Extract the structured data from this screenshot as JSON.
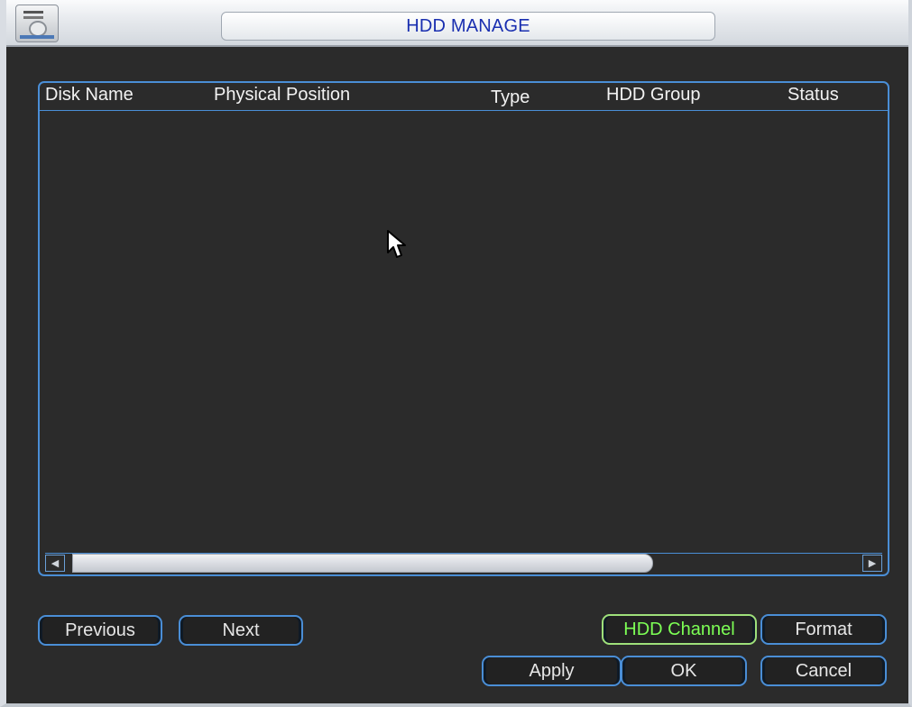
{
  "window": {
    "title": "HDD MANAGE"
  },
  "table": {
    "columns": [
      "Disk Name",
      "Physical Position",
      "Type",
      "HDD Group",
      "Status"
    ],
    "rows": []
  },
  "buttons": {
    "previous": "Previous",
    "next": "Next",
    "hdd_channel": "HDD Channel",
    "format": "Format",
    "apply": "Apply",
    "ok": "OK",
    "cancel": "Cancel"
  },
  "icons": {
    "title": "hdd-icon",
    "cursor": "mouse-pointer-icon",
    "scroll_left": "arrow-left-icon",
    "scroll_right": "arrow-right-icon"
  },
  "colors": {
    "title_text": "#1a2fb0",
    "accent_border": "#4a8ed6",
    "active_button_text": "#7dff55",
    "background": "#2b2b2b"
  }
}
